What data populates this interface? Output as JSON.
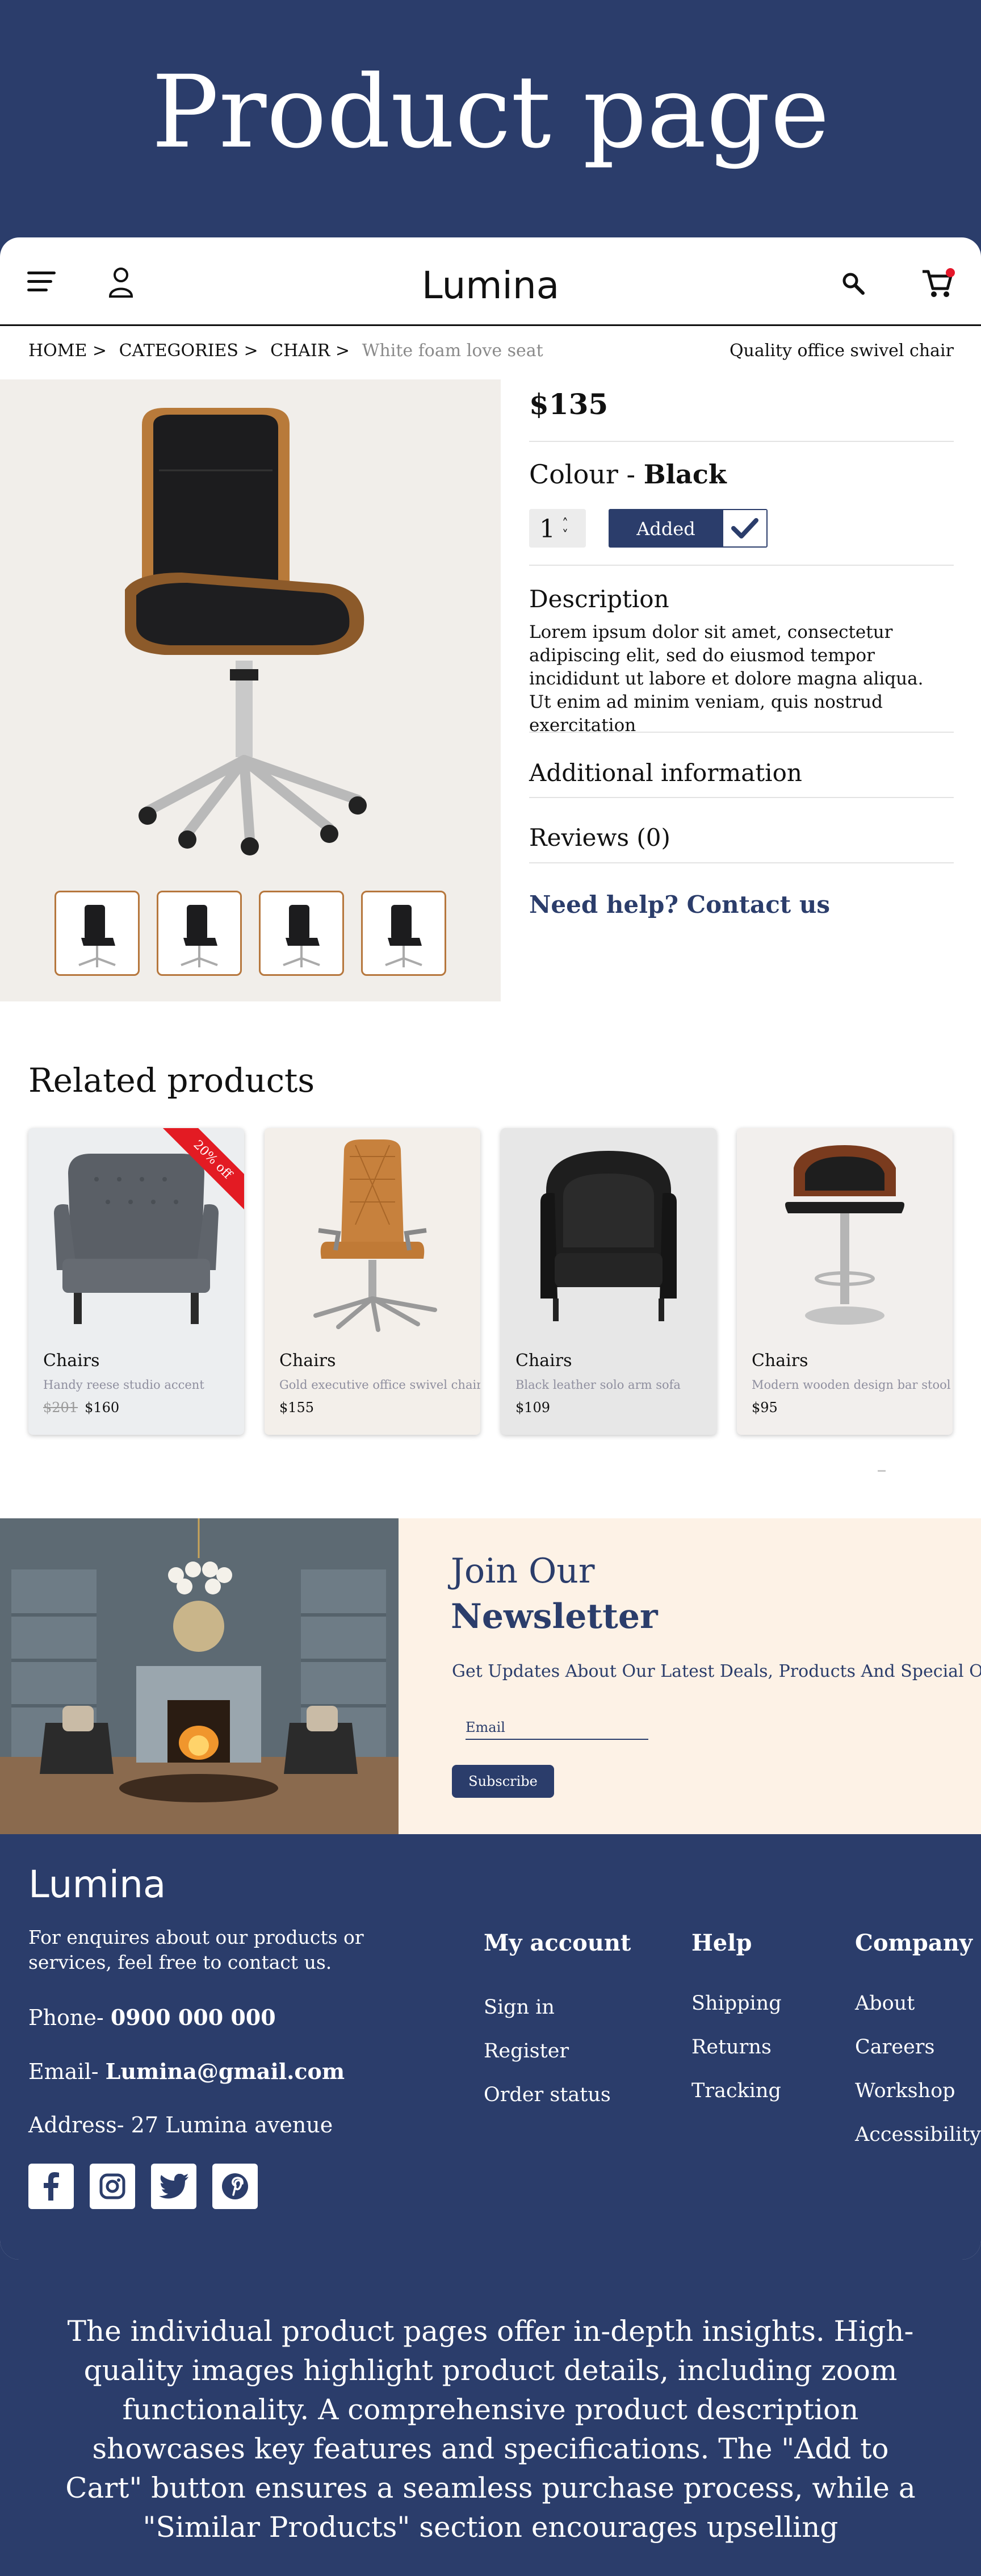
{
  "page_title": "Product page",
  "header": {
    "logo": "Lumina",
    "icons": [
      "menu-icon",
      "user-icon",
      "search-icon",
      "cart-icon"
    ]
  },
  "breadcrumb": {
    "home": "HOME >",
    "categories": "CATEGORIES >",
    "chair": "CHAIR >",
    "current": "White foam love seat"
  },
  "product": {
    "subtitle": "Quality office swivel chair",
    "price": "$135",
    "colour_label": "Colour -",
    "colour_value": "Black",
    "quantity": "1",
    "added_label": "Added",
    "description_title": "Description",
    "description_text": "Lorem ipsum dolor sit amet, consectetur adipiscing elit, sed do eiusmod tempor incididunt ut labore et dolore magna aliqua. Ut enim ad minim veniam, quis nostrud exercitation",
    "additional_info": "Additional information",
    "reviews": "Reviews (0)",
    "help_link": "Need help? Contact us"
  },
  "related": {
    "title": "Related products",
    "items": [
      {
        "category": "Chairs",
        "description": "Handy reese studio accent",
        "old_price": "$201",
        "price": "$160",
        "badge": "20% off",
        "bg": "#eceef0"
      },
      {
        "category": "Chairs",
        "description": "Gold executive office swivel chair",
        "old_price": "",
        "price": "$155",
        "badge": "",
        "bg": "#f3efea"
      },
      {
        "category": "Chairs",
        "description": "Black leather solo arm sofa",
        "old_price": "",
        "price": "$109",
        "badge": "",
        "bg": "#e7e7e7"
      },
      {
        "category": "Chairs",
        "description": "Modern wooden design bar stool",
        "old_price": "",
        "price": "$95",
        "badge": "",
        "bg": "#f2efed"
      }
    ]
  },
  "newsletter": {
    "title_line1": "Join Our",
    "title_line2": "Newsletter",
    "subtitle": "Get Updates About Our Latest Deals, Products And Special Offers",
    "email_placeholder": "Email",
    "subscribe_label": "Subscribe"
  },
  "footer": {
    "logo": "Lumina",
    "about": "For enquires about our products or services, feel free to contact us.",
    "phone_label": "Phone-",
    "phone": "0900 000 000",
    "email_label": "Email-",
    "email": "Lumina@gmail.com",
    "address": "Address- 27 Lumina avenue",
    "social": [
      "facebook-icon",
      "instagram-icon",
      "twitter-icon",
      "pinterest-icon"
    ],
    "columns": [
      {
        "title": "My account",
        "links": [
          "Sign in",
          "Register",
          "Order status"
        ]
      },
      {
        "title": "Help",
        "links": [
          "Shipping",
          "Returns",
          "Tracking"
        ]
      },
      {
        "title": "Company",
        "links": [
          "About",
          "Careers",
          "Workshop",
          "Accessibility"
        ]
      }
    ]
  },
  "bottom_text": "The individual product pages offer in-depth insights. High-quality images highlight product details, including zoom functionality. A comprehensive product description showcases key features and specifications. The \"Add to Cart\" button ensures a seamless purchase process, while a \"Similar Products\" section encourages upselling",
  "colors": {
    "primary": "#2b3d6b",
    "background": "#2b3d6b",
    "newsletter_bg": "#fdf2e6",
    "gallery_bg": "#f1eeea",
    "badge": "#e31b23",
    "cart_dot": "#e5172a"
  }
}
